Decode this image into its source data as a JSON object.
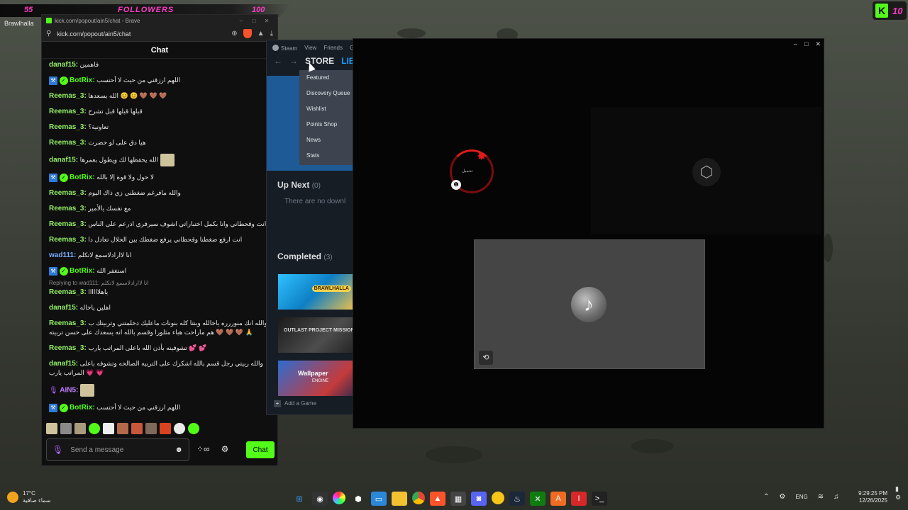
{
  "stream_overlay": {
    "followers_current": "55",
    "followers_label": "FOLLOWERS",
    "followers_goal": "100",
    "game_label": "Brawlhalla",
    "kick_letter": "K",
    "kick_count": "10"
  },
  "browser": {
    "title": "kick.com/popout/ain5/chat - Brave",
    "url": "kick.com/popout/ain5/chat",
    "chat_title": "Chat",
    "messages": [
      {
        "user": "danaf15:",
        "text": "فاهمين"
      },
      {
        "user": "BotRix:",
        "text": "اللهم ارزقني من حيث لا أحتسب"
      },
      {
        "user": "Reemas_3:",
        "text": "الله يسعدها 😊 😊 🤎 🤎 🤎"
      },
      {
        "user": "Reemas_3:",
        "text": "قبلها قبلها قبل تشرح"
      },
      {
        "user": "Reemas_3:",
        "text": "تعاونية؟"
      },
      {
        "user": "Reemas_3:",
        "text": "هيا دق على لو حضرت"
      },
      {
        "user": "danaf15:",
        "text": "الله يحفظها لك ويطول بعمرها"
      },
      {
        "user": "BotRix:",
        "text": "لا حول ولا قوة إلا بالله"
      },
      {
        "user": "Reemas_3:",
        "text": "والله مافرغم ضغطني زي ذاك اليوم"
      },
      {
        "user": "Reemas_3:",
        "text": "مع نفسك يالأمير"
      },
      {
        "user": "Reemas_3:",
        "text": "الحيها انت وقحطاني وانا بكمل اختباراتي اشوف سيرفري اذرعم على الناس"
      },
      {
        "user": "Reemas_3:",
        "text": "انت ارفع ضغطنا وقحطاني يرفع ضغطك بين الحلال تعادل دا"
      },
      {
        "user": "wad111:",
        "text": "انا لاارادلاسمع لاتكلم"
      },
      {
        "user": "BotRix:",
        "text": "استغفر الله"
      },
      {
        "reply": "Replying to wad111: انا لاارادلاسمع لاتكلم",
        "user": "Reemas_3:",
        "text": "ياهلاااااا"
      },
      {
        "user": "danaf15:",
        "text": "اهلين ياخاله"
      },
      {
        "user": "Reemas_3:",
        "text": "ابوالله انك منوررره ياخالله وبنتا كله بنونات ماعليك دخلمتني وتربيتك ب هم ماراحت هباء مثلورا وقسم بالله انه يسعدك على حسن تربيته 🤎 🤎 🤎 🙏"
      },
      {
        "user": "Reemas_3:",
        "text": "تشوفينه بأذن الله باعلى المراتب يارب 💕 💕"
      },
      {
        "user": "danaf15:",
        "text": "والله ربيتي رجل قسم بالله اشكرك على التربيه الصالحه وتشوفه باعلى المراتب يارب 💗 💗"
      },
      {
        "user": "AIN5:",
        "text": ""
      },
      {
        "user": "BotRix:",
        "text": "اللهم ارزقني من حيث لا أحتسب"
      }
    ],
    "composer_placeholder": "Send a message",
    "chat_button": "Chat"
  },
  "steam": {
    "menu": [
      "Steam",
      "View",
      "Friends",
      "G"
    ],
    "tab_store": "STORE",
    "tab_library": "LIBR",
    "store_menu": [
      "Featured",
      "Discovery Queue",
      "Wishlist",
      "Points Shop",
      "News",
      "Stats"
    ],
    "up_next_label": "Up Next",
    "up_next_count": "(0)",
    "up_next_empty": "There are no downl",
    "completed_label": "Completed",
    "completed_count": "(3)",
    "completed_games": [
      {
        "name": "BRAWLHALLA",
        "badge": "10"
      },
      {
        "name": "OUTLAST PROJECT MISSION"
      },
      {
        "name": "Wallpaper",
        "sub": "ENGINE"
      }
    ],
    "add_game": "Add a Game"
  },
  "player": {
    "spinner_text": "تحميل"
  },
  "taskbar": {
    "temperature": "17°C",
    "weather": "سماء صافية",
    "language": "ENG",
    "time": "9:29:25 PM",
    "date": "12/26/2025"
  },
  "colors": {
    "kick_green": "#53fc18",
    "follower_pink": "#ff3cc6",
    "steam_bg": "#171d25",
    "steam_blue": "#1a9fff"
  }
}
